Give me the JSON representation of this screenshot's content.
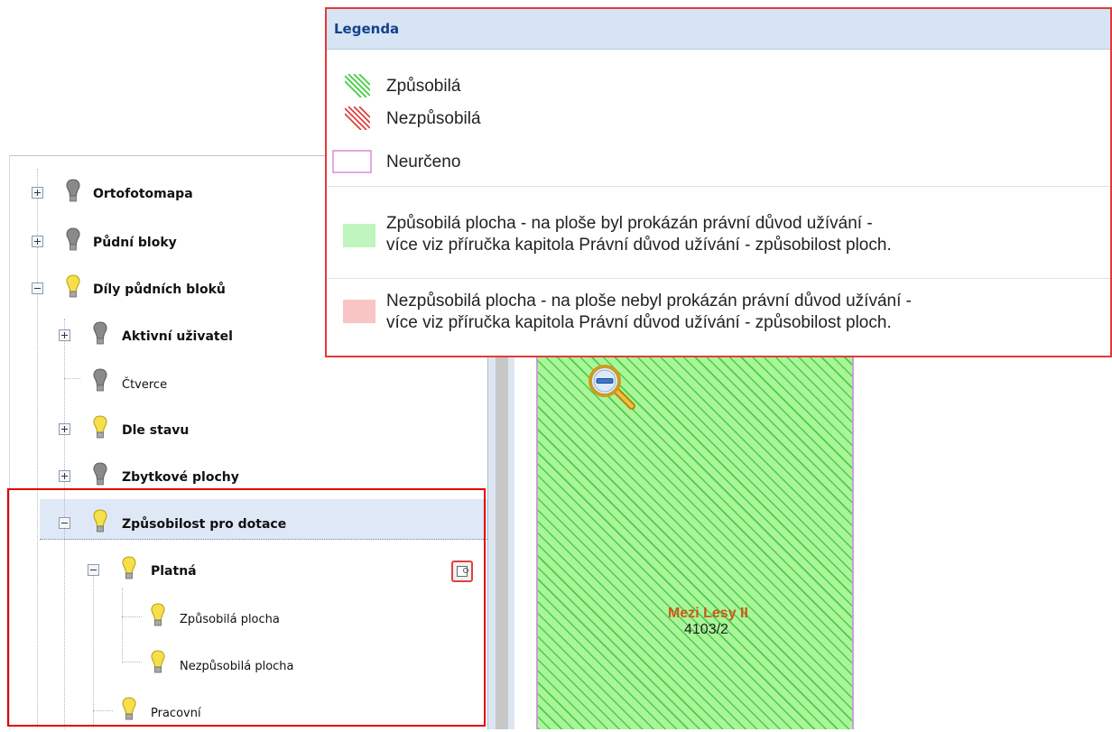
{
  "legend": {
    "title": "Legenda",
    "symbols": [
      {
        "label": "Způsobilá",
        "pattern": "green-hatch",
        "color": "#33cc33"
      },
      {
        "label": "Nezpůsobilá",
        "pattern": "red-hatch",
        "color": "#e03030"
      },
      {
        "label": "Neurčeno",
        "pattern": "outline",
        "color": "#d070d0"
      }
    ],
    "descriptions": [
      {
        "line1": "Způsobilá plocha - na ploše byl prokázán právní důvod užívání -",
        "line2": "více viz příručka kapitola Právní důvod užívání - způsobilost ploch.",
        "color": "#bff5bf"
      },
      {
        "line1": "Nezpůsobilá plocha - na ploše nebyl prokázán právní důvod užívání -",
        "line2": "více viz příručka kapitola Právní důvod užívání - způsobilost ploch.",
        "color": "#f8c4c4"
      }
    ]
  },
  "tree": {
    "items": [
      {
        "label": "Ortofotomapa",
        "bulb": "off",
        "expander": "plus"
      },
      {
        "label": "Půdní bloky",
        "bulb": "off",
        "expander": "plus"
      },
      {
        "label": "Díly půdních bloků",
        "bulb": "on",
        "expander": "minus"
      },
      {
        "label": "Aktivní uživatel",
        "bulb": "off",
        "expander": "plus"
      },
      {
        "label": "Čtverce",
        "bulb": "off",
        "expander": "none"
      },
      {
        "label": "Dle stavu",
        "bulb": "on",
        "expander": "plus"
      },
      {
        "label": "Zbytkové plochy",
        "bulb": "off",
        "expander": "plus"
      },
      {
        "label": "Způsobilost pro dotace",
        "bulb": "on",
        "expander": "minus",
        "selected": true
      },
      {
        "label": "Platná",
        "bulb": "on",
        "expander": "minus"
      },
      {
        "label": "Způsobilá plocha",
        "bulb": "on",
        "expander": "none"
      },
      {
        "label": "Nezpůsobilá plocha",
        "bulb": "on",
        "expander": "none"
      },
      {
        "label": "Pracovní",
        "bulb": "on",
        "expander": "none"
      }
    ]
  },
  "map": {
    "parcel_name": "Mezi Lesy II",
    "parcel_number": "4103/2",
    "zoom_icon": "zoom-out-icon"
  },
  "colors": {
    "bulb_on": "#f5e04a",
    "bulb_off": "#8a8a8a",
    "highlight": "#e00000",
    "header_bg": "#d7e4f3",
    "header_text": "#15428b"
  }
}
